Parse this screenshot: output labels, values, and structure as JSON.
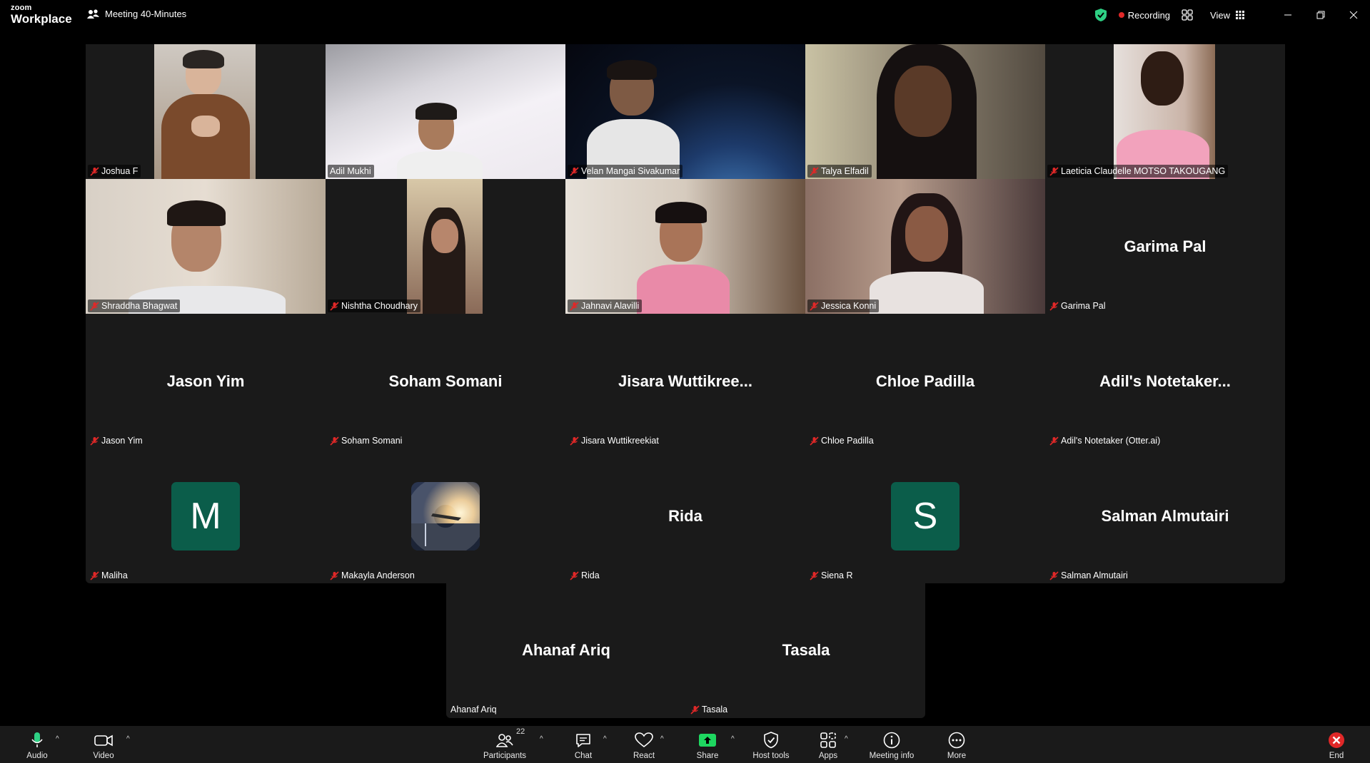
{
  "app": {
    "brand_top": "zoom",
    "brand_bottom": "Workplace"
  },
  "meeting": {
    "title": "Meeting 40-Minutes"
  },
  "titlebar": {
    "recording_label": "Recording",
    "view_label": "View",
    "recording_color": "#e02828",
    "shield_color": "#2ed084"
  },
  "participants": [
    {
      "display": "Joshua F",
      "label": "Joshua F",
      "muted": true
    },
    {
      "display": "Adil Mukhi",
      "label": "Adil Mukhi",
      "muted": false,
      "active_speaker": true
    },
    {
      "display": "Velan Mangai Sivakumar",
      "label": "Velan Mangai Sivakumar",
      "muted": true
    },
    {
      "display": "Talya Elfadil",
      "label": "Talya Elfadil",
      "muted": true
    },
    {
      "display": "Laeticia Claudelle MOTSO TAKOUGANG",
      "label": "Laeticia Claudelle MOTSO TAKOUGANG",
      "muted": true
    },
    {
      "display": "Shraddha Bhagwat",
      "label": "Shraddha Bhagwat",
      "muted": true
    },
    {
      "display": "Nishtha Choudhary",
      "label": "Nishtha Choudhary",
      "muted": true
    },
    {
      "display": "Jahnavi Alavilli",
      "label": "Jahnavi Alavilli",
      "muted": true
    },
    {
      "display": "Jessica  Konni",
      "label": "Jessica  Konni",
      "muted": true
    },
    {
      "display": "Garima Pal",
      "label": "Garima Pal",
      "muted": true
    },
    {
      "display": "Jason Yim",
      "label": "Jason Yim",
      "muted": true
    },
    {
      "display": "Soham Somani",
      "label": "Soham Somani",
      "muted": true
    },
    {
      "display": "Jisara  Wuttikree...",
      "label": "Jisara Wuttikreekiat",
      "muted": true
    },
    {
      "display": "Chloe Padilla",
      "label": "Chloe Padilla",
      "muted": true
    },
    {
      "display": "Adil's  Notetaker...",
      "label": "Adil's Notetaker (Otter.ai)",
      "muted": true
    },
    {
      "display": "M",
      "label": "Maliha",
      "muted": true
    },
    {
      "display": "",
      "label": "Makayla Anderson",
      "muted": true
    },
    {
      "display": "Rida",
      "label": "Rida",
      "muted": true
    },
    {
      "display": "S",
      "label": "Siena R",
      "muted": true
    },
    {
      "display": "Salman Almutairi",
      "label": "Salman Almutairi",
      "muted": true
    },
    {
      "display": "Ahanaf Ariq",
      "label": "Ahanaf Ariq",
      "muted": false
    },
    {
      "display": "Tasala",
      "label": "Tasala",
      "muted": true
    }
  ],
  "toolbar": {
    "audio": "Audio",
    "video": "Video",
    "participants": "Participants",
    "participants_count": "22",
    "chat": "Chat",
    "react": "React",
    "share": "Share",
    "host_tools": "Host tools",
    "apps": "Apps",
    "meeting_info": "Meeting info",
    "more": "More",
    "end": "End",
    "share_color": "#1ed760",
    "end_color": "#e02828",
    "audio_icon_color": "#2ed084"
  }
}
